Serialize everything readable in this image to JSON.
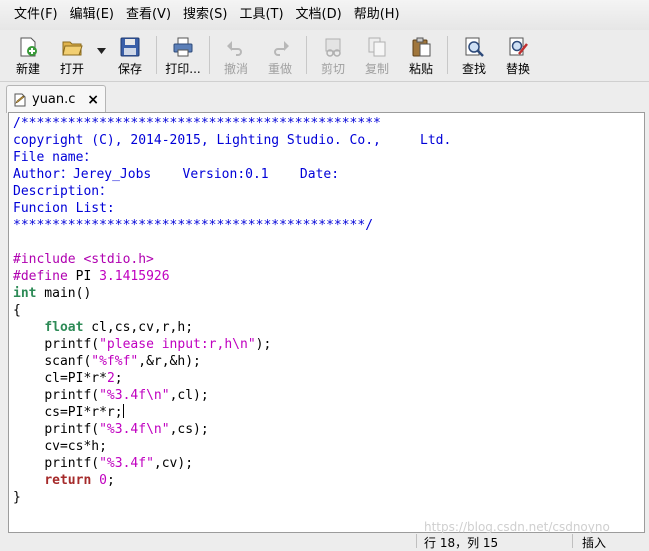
{
  "menu": [
    "文件(F)",
    "编辑(E)",
    "查看(V)",
    "搜索(S)",
    "工具(T)",
    "文档(D)",
    "帮助(H)"
  ],
  "toolbar": {
    "new": "新建",
    "open": "打开",
    "save": "保存",
    "print": "打印...",
    "undo": "撤消",
    "redo": "重做",
    "cut": "剪切",
    "copy": "复制",
    "paste": "粘贴",
    "find": "查找",
    "replace": "替换"
  },
  "tab": {
    "label": "yuan.c",
    "close": "×"
  },
  "code": {
    "l1": "/**********************************************",
    "l2": "copyright (C), 2014-2015, Lighting Studio. Co.,     Ltd.",
    "l3": "File name：",
    "l4": "Author：Jerey_Jobs    Version:0.1    Date:",
    "l5": "Description：",
    "l6": "Funcion List:",
    "l7": "*********************************************/",
    "inc": "#include <stdio.h>",
    "def_kw": "#define",
    "def_name": " PI ",
    "def_val": "3.1415926",
    "int_kw": "int",
    "main_sig": " main()",
    "brace_open": "{",
    "float_kw": "float",
    "decl": " cl,cs,cv,r,h;",
    "printf": "printf(",
    "scanf": "scanf(",
    "s_prompt": "\"please input:r,h\\n\"",
    "s_scan": "\"%f%f\"",
    "scan_args": ",&r,&h);",
    "cl_eq": "cl=PI*r*",
    "two": "2",
    "s_fmt_nl": "\"%3.4f\\n\"",
    "cl_arg": ",cl);",
    "cs_eq": "cs=PI*r*r;",
    "cs_arg": ",cs);",
    "cv_eq": "cv=cs*h;",
    "s_fmt": "\"%3.4f\"",
    "cv_arg": ",cv);",
    "close_paren": ");",
    "semi": ";",
    "ret_kw": "return",
    "zero": "0",
    "brace_close": "}"
  },
  "status": {
    "position": "行 18，列 15",
    "mode": "插入"
  },
  "watermark": "https://blog.csdn.net/csdnoyno",
  "colors": {
    "comment": "#0000d8",
    "preprocessor": "#b000b0",
    "string": "#c000c0",
    "keyword": "#2e8b57",
    "return": "#a52a2a"
  }
}
